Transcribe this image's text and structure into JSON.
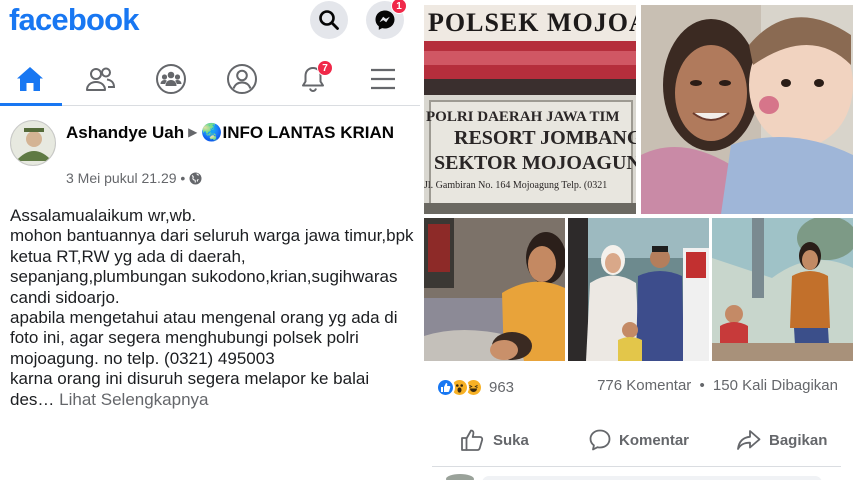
{
  "app": {
    "logo_text": "facebook",
    "brand_color": "#1877f2",
    "messenger_badge": "1",
    "notifications_badge": "7"
  },
  "nav": {
    "items": [
      {
        "name": "home",
        "icon": "home-icon",
        "active": true
      },
      {
        "name": "friends",
        "icon": "friends-icon",
        "active": false
      },
      {
        "name": "groups",
        "icon": "groups-icon",
        "active": false
      },
      {
        "name": "profile",
        "icon": "profile-icon",
        "active": false
      },
      {
        "name": "notifications",
        "icon": "bell-icon",
        "active": false
      },
      {
        "name": "menu",
        "icon": "hamburger-menu-icon",
        "active": false
      }
    ]
  },
  "post": {
    "author": "Ashandye Uah",
    "group": "🌏INFO LANTAS KRIAN",
    "timestamp": "3 Mei pukul 21.29",
    "audience_icon": "globe-icon",
    "body": "Assalamualaikum wr,wb.\nmohon bantuannya dari seluruh warga jawa timur,bpk ketua RT,RW yg ada di daerah, sepanjang,plumbungan sukodono,krian,sugihwaras candi sidoarjo.\napabila mengetahui atau mengenal orang yg ada di foto ini, agar segera menghubungi polsek polri mojoagung.  no telp. (0321) 495003\nkarna orang ini disuruh segera melapor ke balai des…",
    "see_more": "Lihat Selengkapnya"
  },
  "photo_sign": {
    "line1": "POLSEK MOJOA",
    "line2": "POLRI DAERAH JAWA TIM",
    "line3": "RESORT JOMBANG",
    "line4": "SEKTOR MOJOAGUNG",
    "line5": "Jl. Gambiran No. 164 Mojoagung Telp. (0321"
  },
  "engagement": {
    "reactions": [
      "like",
      "wow",
      "haha"
    ],
    "reaction_count": "963",
    "comments": "776 Komentar",
    "shares": "150 Kali Dibagikan",
    "separator": "•"
  },
  "actions": {
    "like": "Suka",
    "comment": "Komentar",
    "share": "Bagikan"
  }
}
